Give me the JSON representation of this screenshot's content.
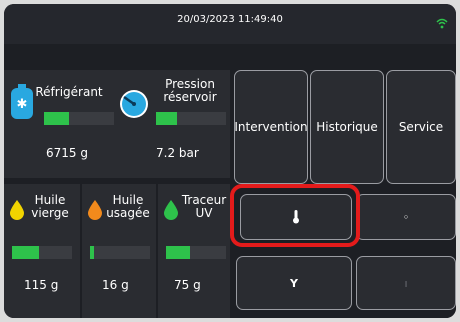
{
  "status_bar": {
    "datetime": "20/03/2023 11:49:40",
    "wifi_icon": "wifi-icon",
    "wifi_color": "#2ec24b"
  },
  "gauges": {
    "refrigerant": {
      "label_line1": "Réfrigérant",
      "value": "6715 g",
      "level": 0.35,
      "icon": "gas-bottle-icon"
    },
    "tank_pressure": {
      "label_line1": "Pression",
      "label_line2": "réservoir",
      "value": "7.2 bar",
      "level": 0.3,
      "icon": "pressure-gauge-icon"
    },
    "virgin_oil": {
      "label_line1": "Huile",
      "label_line2": "vierge",
      "value": "115 g",
      "level": 0.45,
      "icon": "oil-drop-yellow-icon",
      "color": "#f1d400"
    },
    "used_oil": {
      "label_line1": "Huile",
      "label_line2": "usagée",
      "value": "16 g",
      "level": 0.05,
      "icon": "oil-drop-orange-icon",
      "color": "#f28a1c"
    },
    "uv_tracer": {
      "label_line1": "Traceur",
      "label_line2": "UV",
      "value": "75 g",
      "level": 0.4,
      "icon": "oil-drop-green-icon",
      "color": "#2ec24b"
    }
  },
  "menu": {
    "intervention": "Intervention",
    "historique": "Historique",
    "service": "Service"
  },
  "tools": {
    "tool1_icon": "thermometer-icon",
    "tool2_icon": "settings-icon",
    "tool3_icon": "filter-icon",
    "tool4_icon": "info-icon"
  },
  "colors": {
    "accent_green": "#2ec24b",
    "highlight_red": "#e41b1b",
    "background": "#1d1f24"
  }
}
